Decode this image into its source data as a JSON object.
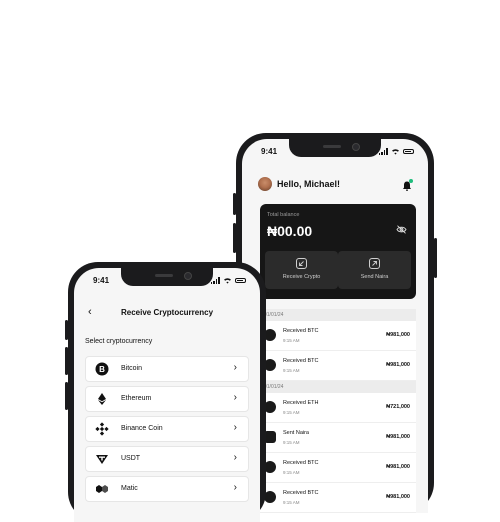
{
  "back_phone": {
    "status_time": "9:41",
    "greeting": "Hello, Michael!",
    "balance_label": "Total balance",
    "balance_amount": "₦00.00",
    "actions": [
      {
        "label": "Receive Crypto",
        "icon": "arrow-down-left-icon"
      },
      {
        "label": "Send Naira",
        "icon": "arrow-up-right-icon"
      }
    ],
    "transactions": [
      {
        "date": "01/01/24",
        "items": [
          {
            "title": "Received BTC",
            "time": "9:15 AM",
            "amount": "₦981,000"
          },
          {
            "title": "Received BTC",
            "time": "9:15 AM",
            "amount": "₦981,000"
          }
        ]
      },
      {
        "date": "01/01/24",
        "items": [
          {
            "title": "Received ETH",
            "time": "9:15 AM",
            "amount": "₦721,000"
          },
          {
            "title": "Sent Naira",
            "time": "9:15 AM",
            "amount": "₦981,000"
          },
          {
            "title": "Received BTC",
            "time": "9:15 AM",
            "amount": "₦981,000"
          },
          {
            "title": "Received BTC",
            "time": "9:15 AM",
            "amount": "₦981,000"
          }
        ]
      }
    ]
  },
  "front_phone": {
    "status_time": "9:41",
    "title": "Receive Cryptocurrency",
    "select_label": "Select cryptocurrency",
    "coins": [
      {
        "name": "Bitcoin",
        "icon": "bitcoin-icon"
      },
      {
        "name": "Ethereum",
        "icon": "ethereum-icon"
      },
      {
        "name": "Binance Coin",
        "icon": "binance-icon"
      },
      {
        "name": "USDT",
        "icon": "tether-icon"
      },
      {
        "name": "Matic",
        "icon": "polygon-icon"
      }
    ]
  },
  "colors": {
    "accent": "#1ebc7c",
    "card": "#161616",
    "background": "#ffffff"
  }
}
